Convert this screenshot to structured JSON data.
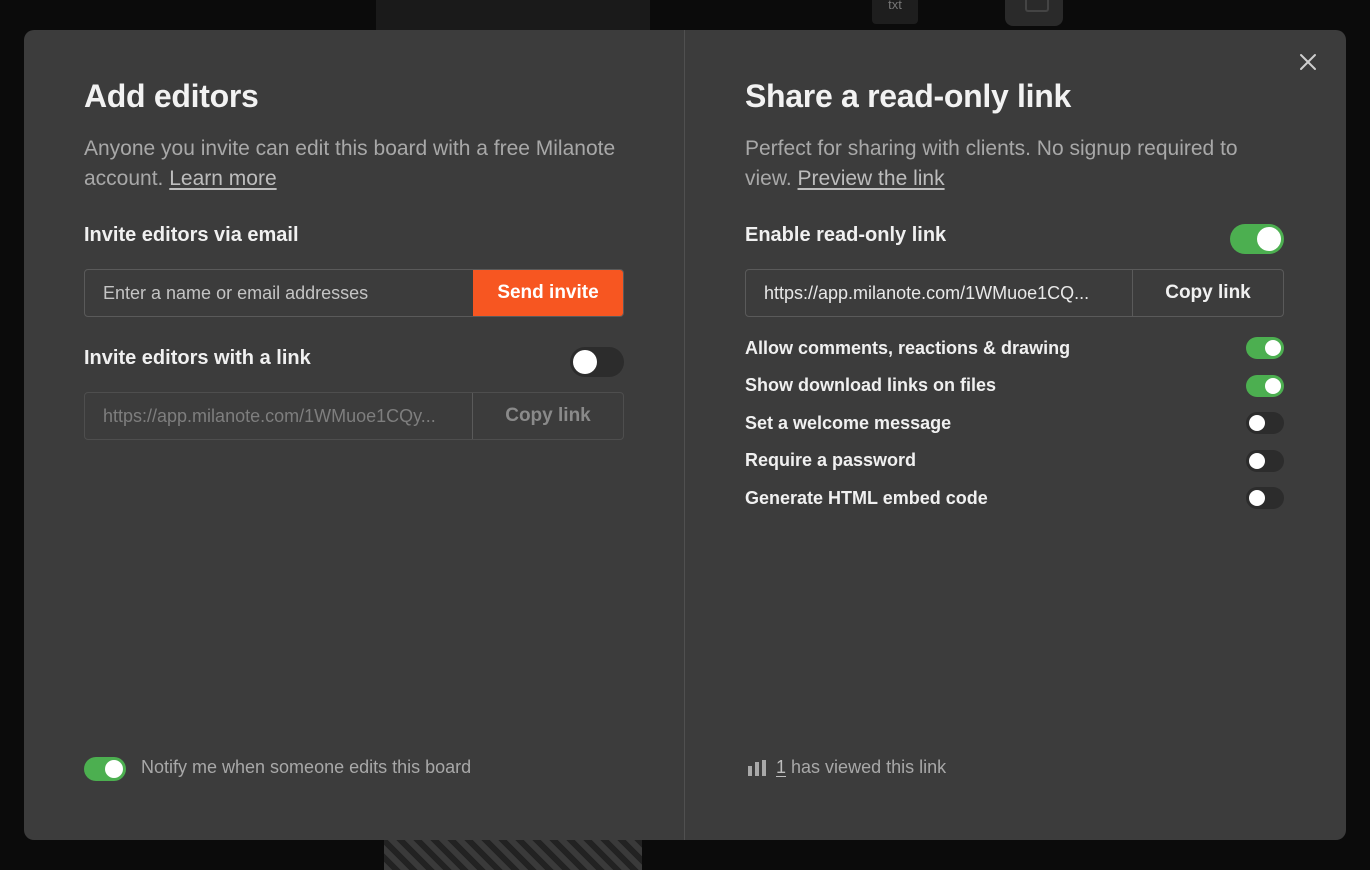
{
  "background": {
    "file_badge": "txt"
  },
  "left": {
    "title": "Add editors",
    "description": "Anyone you invite can edit this board with a free Milanote account.",
    "learn_more": "Learn more",
    "invite_email_label": "Invite editors via email",
    "email_placeholder": "Enter a name or email addresses",
    "send_invite": "Send invite",
    "invite_link_label": "Invite editors with a link",
    "invite_link_enabled": false,
    "invite_link_url": "https://app.milanote.com/1WMuoe1CQy...",
    "copy_link": "Copy link",
    "notify_enabled": true,
    "notify_label": "Notify me when someone edits this board"
  },
  "right": {
    "title": "Share a read-only link",
    "description": "Perfect for sharing with clients. No signup required to view.",
    "preview_link": "Preview the link",
    "enable_label": "Enable read-only link",
    "enable_on": true,
    "link_url": "https://app.milanote.com/1WMuoe1CQ...",
    "copy_link": "Copy link",
    "options": [
      {
        "label": "Allow comments, reactions & drawing",
        "on": true
      },
      {
        "label": "Show download links on files",
        "on": true
      },
      {
        "label": "Set a welcome message",
        "on": false
      },
      {
        "label": "Require a password",
        "on": false
      },
      {
        "label": "Generate HTML embed code",
        "on": false
      }
    ],
    "views_count": "1",
    "views_text": "has viewed this link"
  },
  "colors": {
    "accent": "#f75621",
    "toggle_on": "#4caf50",
    "modal_bg": "#3c3c3c"
  }
}
